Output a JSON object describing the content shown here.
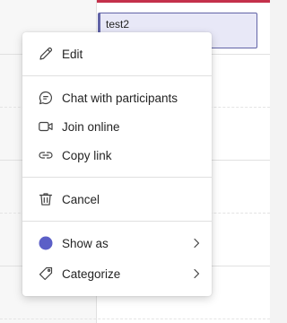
{
  "calendar": {
    "event": {
      "title": "test2",
      "color": "#6264a7"
    },
    "now_line_color": "#c4314b"
  },
  "menu": {
    "items": [
      {
        "label": "Edit",
        "icon": "edit-icon"
      },
      {
        "label": "Chat with participants",
        "icon": "chat-icon"
      },
      {
        "label": "Join online",
        "icon": "video-camera-icon"
      },
      {
        "label": "Copy link",
        "icon": "link-icon"
      },
      {
        "label": "Cancel",
        "icon": "trash-icon"
      },
      {
        "label": "Show as",
        "icon": "status-dot-icon",
        "status_color": "#5b5fc7",
        "has_submenu": true
      },
      {
        "label": "Categorize",
        "icon": "tag-icon",
        "has_submenu": true
      }
    ]
  }
}
